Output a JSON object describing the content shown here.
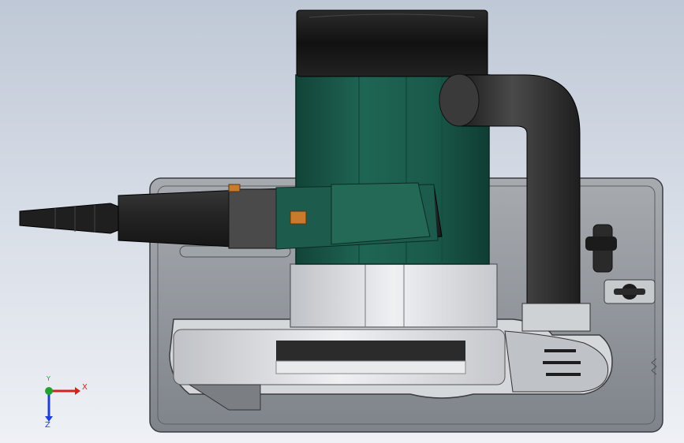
{
  "viewport": {
    "background_top": "#bfc8d6",
    "background_bottom": "#eef1f5"
  },
  "model": {
    "body_color": "#1e5a4c",
    "motor_cap_color": "#1a1a1a",
    "handle_color": "#2d2d2d",
    "base_plate_color": "#8f949a",
    "housing_color": "#d9dcdf",
    "switch_color": "#c97a2a"
  },
  "triad": {
    "x_label": "X",
    "y_label": "Y",
    "z_label": "Z",
    "x_color": "#d2231e",
    "y_color": "#1fa32a",
    "z_color": "#1f3fd6"
  }
}
